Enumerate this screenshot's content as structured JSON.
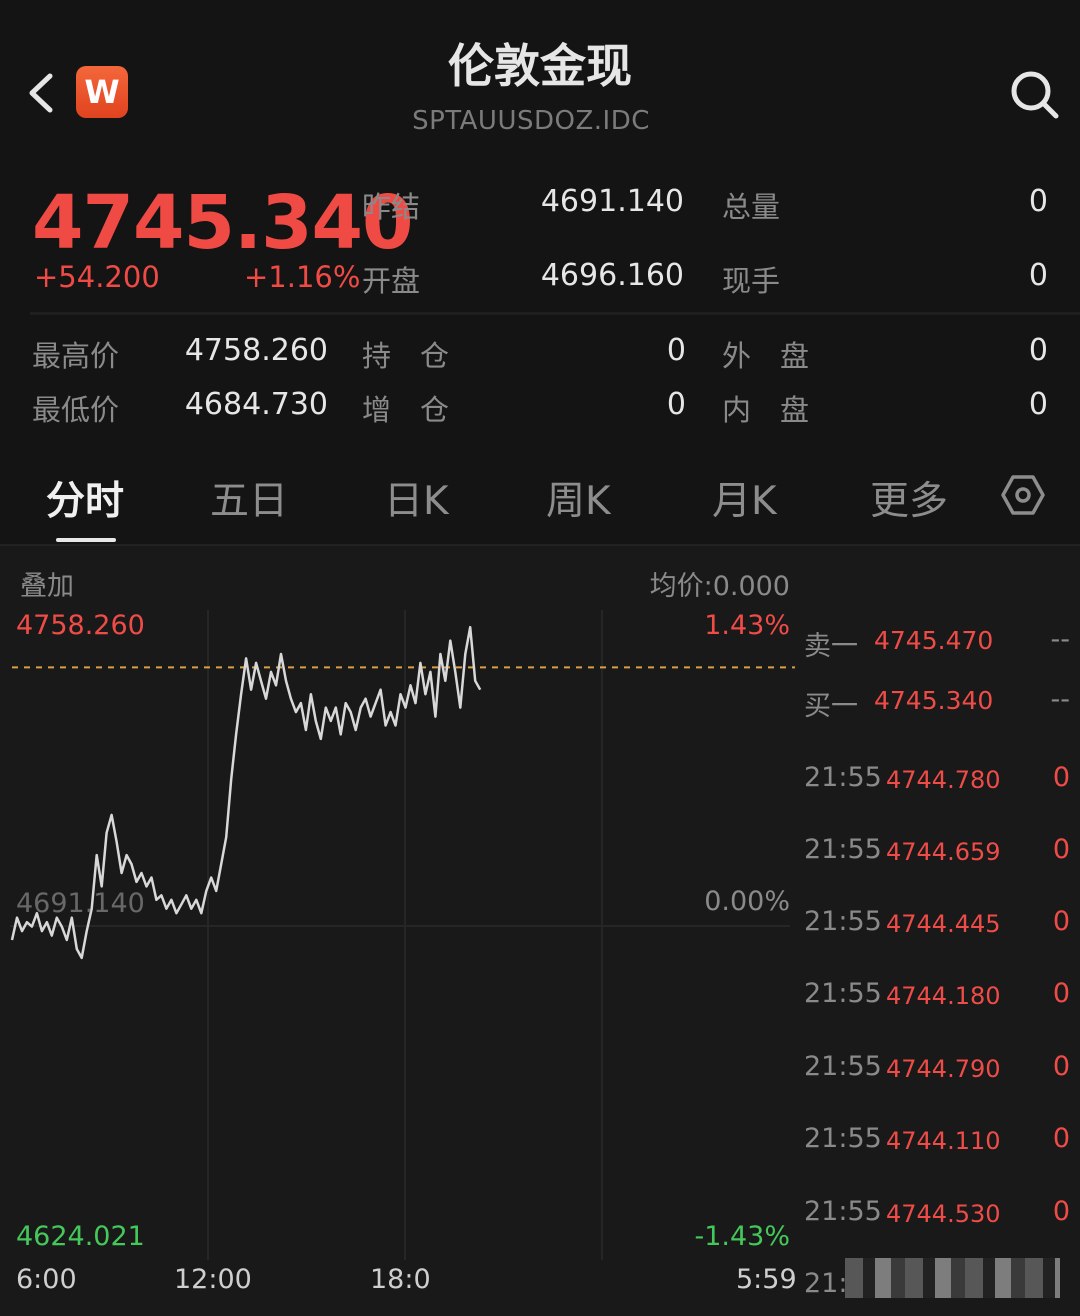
{
  "header": {
    "title": "伦敦金现",
    "subtitle": "SPTAUUSDOZ.IDC",
    "logo_letter": "W"
  },
  "quote": {
    "price": "4745.340",
    "change": "+54.200",
    "change_pct": "+1.16%",
    "prev_close_label": "昨结",
    "prev_close": "4691.140",
    "open_label": "开盘",
    "open": "4696.160",
    "volume_label": "总量",
    "volume": "0",
    "current_hand_label": "现手",
    "current_hand": "0",
    "high_label": "最高价",
    "high": "4758.260",
    "low_label": "最低价",
    "low": "4684.730",
    "position_label": "持　仓",
    "position": "0",
    "add_position_label": "增　仓",
    "add_position": "0",
    "outer_label": "外　盘",
    "outer": "0",
    "inner_label": "内　盘",
    "inner": "0"
  },
  "tabs": [
    "分时",
    "五日",
    "日K",
    "周K",
    "月K",
    "更多"
  ],
  "chart_labels": {
    "overlay": "叠加",
    "avg_price": "均价:0.000",
    "y_high": "4758.260",
    "y_mid": "4691.140",
    "y_low": "4624.021",
    "pct_high": "1.43%",
    "pct_mid": "0.00%",
    "pct_low": "-1.43%",
    "x_ticks": [
      "6:00",
      "12:00",
      "18:0",
      "5:59"
    ]
  },
  "order_book": {
    "ask_label": "卖一",
    "ask_price": "4745.470",
    "ask_vol": "--",
    "bid_label": "买一",
    "bid_price": "4745.340",
    "bid_vol": "--",
    "trades": [
      {
        "time": "21:55",
        "price": "4744.780",
        "vol": "0"
      },
      {
        "time": "21:55",
        "price": "4744.659",
        "vol": "0"
      },
      {
        "time": "21:55",
        "price": "4744.445",
        "vol": "0"
      },
      {
        "time": "21:55",
        "price": "4744.180",
        "vol": "0"
      },
      {
        "time": "21:55",
        "price": "4744.790",
        "vol": "0"
      },
      {
        "time": "21:55",
        "price": "4744.110",
        "vol": "0"
      },
      {
        "time": "21:55",
        "price": "4744.530",
        "vol": "0"
      }
    ],
    "last_partial_time": "21:"
  },
  "colors": {
    "up": "#ef4c48",
    "down": "#45c85a",
    "line": "#d8d8d8",
    "background": "#141414"
  },
  "chart_data": {
    "type": "line",
    "ylim": [
      4624.021,
      4758.26
    ],
    "reference": 4691.14,
    "x": [
      0,
      1,
      2,
      3,
      4,
      5,
      6,
      7,
      8,
      9,
      10,
      11,
      12,
      13,
      14,
      15,
      16,
      17,
      18,
      19,
      20,
      21,
      22,
      23,
      24,
      25,
      26,
      27,
      28,
      29,
      30,
      31,
      32,
      33,
      34,
      35,
      36,
      37,
      38,
      39,
      40,
      41,
      42,
      43,
      44,
      45,
      46,
      47,
      48,
      49,
      50,
      51,
      52,
      53,
      54,
      55,
      56,
      57,
      58,
      59,
      60,
      61,
      62,
      63,
      64,
      65,
      66,
      67,
      68,
      69,
      70,
      71,
      72,
      73,
      74,
      75,
      76,
      77,
      78,
      79,
      80,
      81,
      82,
      83,
      84,
      85,
      86,
      87,
      88,
      89,
      90,
      91,
      92,
      93,
      94,
      95,
      96,
      97,
      98,
      99,
      100,
      101,
      102,
      103,
      104,
      105
    ],
    "series": [
      {
        "values": [
          4688,
          4693,
          4690,
          4692,
          4691,
          4694,
          4690,
          4692,
          4689,
          4693,
          4691,
          4688,
          4693,
          4686,
          4684,
          4690,
          4695,
          4707,
          4700,
          4712,
          4716,
          4710,
          4703,
          4707,
          4705,
          4701,
          4703,
          4700,
          4702,
          4697,
          4698,
          4695,
          4697,
          4694,
          4696,
          4698,
          4695,
          4697,
          4694,
          4699,
          4702,
          4699,
          4705,
          4711,
          4724,
          4734,
          4743,
          4751,
          4744,
          4750,
          4746,
          4742,
          4748,
          4745,
          4752,
          4746,
          4742,
          4739,
          4741,
          4735,
          4743,
          4737,
          4733,
          4740,
          4737,
          4740,
          4734,
          4741,
          4739,
          4735,
          4740,
          4742,
          4738,
          4741,
          4744,
          4736,
          4739,
          4736,
          4743,
          4740,
          4745,
          4741,
          4750,
          4743,
          4748,
          4738,
          4752,
          4746,
          4755,
          4748,
          4740,
          4752,
          4758,
          4746,
          4744
        ],
        "color": "#d8d8d8"
      }
    ],
    "x_ticks": [
      "6:00",
      "12:00",
      "18:0",
      "5:59"
    ]
  }
}
